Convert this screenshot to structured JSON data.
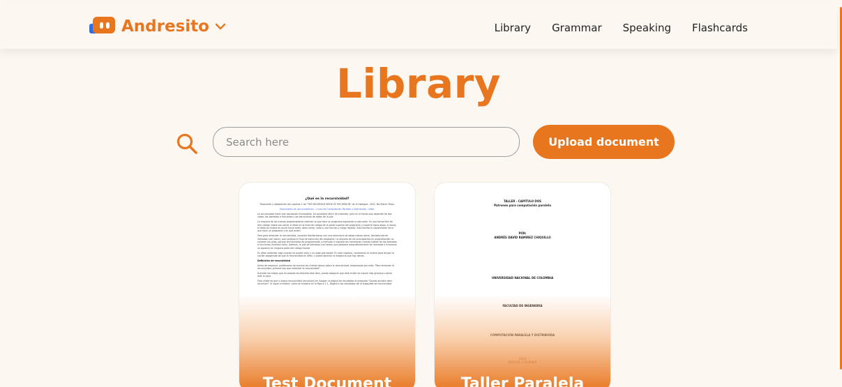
{
  "brand": {
    "name": "Andresito",
    "icon": "robot-logo-icon",
    "menu_icon": "chevron-down-icon"
  },
  "nav": {
    "links": [
      "Library",
      "Grammar",
      "Speaking",
      "Flashcards"
    ]
  },
  "page": {
    "title": "Library"
  },
  "search": {
    "placeholder": "Search here",
    "value": "",
    "icon": "search-icon"
  },
  "upload": {
    "label": "Upload document"
  },
  "colors": {
    "accent": "#e8761f",
    "background": "#fdf7f1",
    "logo_blue": "#2f6fe0"
  },
  "documents": [
    {
      "title": "Test Document",
      "preview": {
        "heading": "¿Qué es la recursividad?",
        "subtitle": "Traducción y adaptación del capítulo 1 de \"THE RECURSIVE BOOK OF RECURSION\" de Al Sweigart. 2022. No Starch Press.",
        "note": "Documento de uso académico – Curso de Computación Paralela y Distribuida – UNAL",
        "paragraphs": [
          "La recursividad tiene una reputación intimidante. Se considera difícil de entender, pero en el fondo solo depende de dos cosas: las llamadas a funciones y las estructuras de datos de la pila.",
          "La mayoría de los nuevos programadores rastrean lo que hace un programa siguiendo la ejecución. Es una forma fácil de leer código: basta con poner el dedo en la línea de código de la parte superior del programa y moverlo hacia abajo. A veces, el dedo se mueve en bucle hacia atrás; otras veces, salta a una función y luego regresa. Esto facilita la visualización de lo que hace un programa y en qué orden.",
          "Pero para entender la recursividad, necesita familiarizarse con una estructura de datos menos obvia, llamada pila de llamadas (call stack), que controla el flujo de ejecución del programa. La mayoría de los principiantes en programación no conocen las pilas, porque los tutoriales de programación a menudo ni siquiera las mencionan cuando hablan de las llamadas a funciones (function calls). Además, la pila de llamadas (call stack) que gestiona automáticamente las llamadas a funciones no aparece en ninguna parte del código fuente.",
          "Es difícil entender algo cuando no puede verlo y no sabe que existe. En este capítulo, correremos la cortina para disipar la noción exagerada de que la recursividad es difícil, y podrá apreciar la elegancia que hay detrás."
        ],
        "section": "Definición de recursividad",
        "paragraphs2": [
          "Antes de empezar, quitémonos de encima los chistes típicos sobre la recursividad, empezando por este: \"Para entender la recursividad, primero hay que entender la recursividad\".",
          "Durante los meses que he pasado escribiendo este libro, puedo asegurar que este chiste se vuelve más gracioso cuanto más lo oyes.",
          "Otro chiste es que si busca recursividad (recursion) en Google, la página de resultados le pregunta \"Quizás quisiste decir recursion\". Si sigue el enlace, como se muestra en la Figura 1-1, llegará a los resultados de la búsqueda de recursividad."
        ]
      }
    },
    {
      "title": "Taller Paralela",
      "preview": {
        "line1": "TALLER - CAPITULO DOS",
        "line2": "Patrones para computación paralela",
        "por": "POR:",
        "author": "ANDRÉS DAVID RAMIREZ CHIQUILLO",
        "university": "UNIVERSIDAD NACIONAL DE COLOMBIA",
        "faculty": "FACULTAD DE INGENIERÍA",
        "course": "COMPUTACIÓN PARALELA Y DISTRIBUIDA",
        "year": "2024",
        "city": "BOGOTÁ, COLOMBIA"
      }
    }
  ]
}
